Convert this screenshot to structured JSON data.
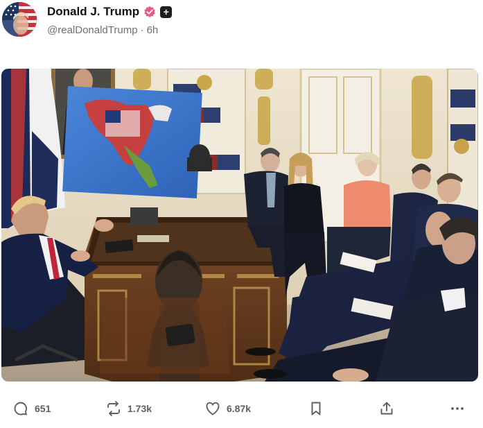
{
  "post": {
    "author": {
      "display_name": "Donald J. Trump",
      "handle": "@realDonaldTrump",
      "separator": "·",
      "time": "6h",
      "verified_color": "#e85a80",
      "icons": [
        "avatar-flag-portrait",
        "verified-badge-icon",
        "plus-badge-icon"
      ]
    },
    "plus_symbol": "+",
    "image": {
      "description_icon": "photo-oval-office-meeting"
    },
    "actions": {
      "reply_count": "651",
      "repost_count": "1.73k",
      "like_count": "6.87k",
      "icons": [
        "reply-icon",
        "repost-icon",
        "like-icon",
        "bookmark-icon",
        "share-icon",
        "more-icon"
      ]
    }
  }
}
